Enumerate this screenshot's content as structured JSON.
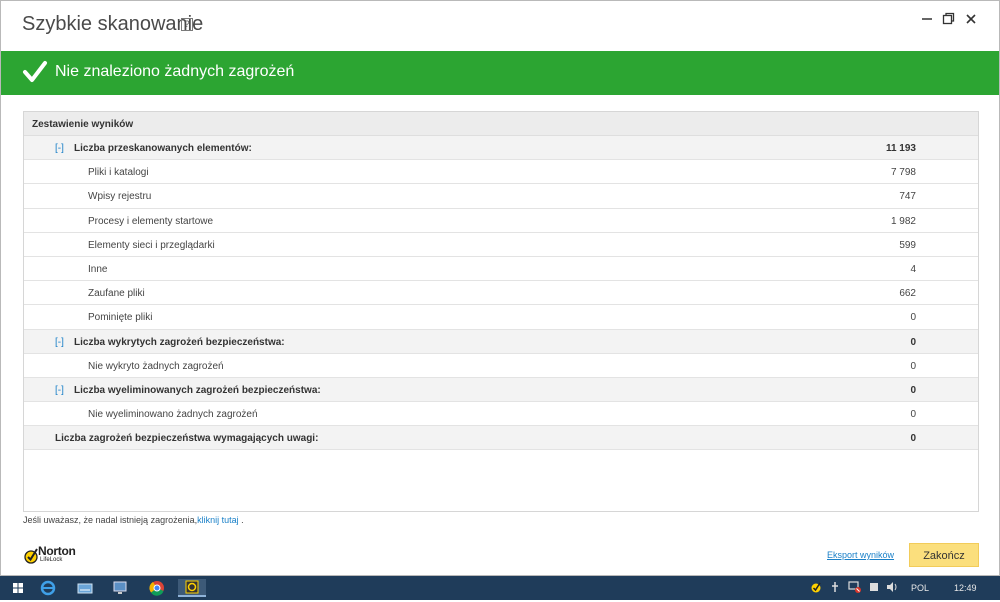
{
  "window": {
    "title": "Szybkie skanowanie",
    "help_label": "?",
    "minimize_icon": "minimize-icon",
    "restore_icon": "restore-icon",
    "close_icon": "close-icon"
  },
  "banner": {
    "text": "Nie znaleziono żadnych zagrożeń",
    "icon": "checkmark-icon",
    "color": "#2ca532"
  },
  "summary": {
    "header": "Zestawienie wyników",
    "toggle_label": "[-]",
    "rows": [
      {
        "label": "Liczba przeskanowanych elementów:",
        "value": "11 193"
      },
      {
        "label": "Pliki i katalogi",
        "value": "7 798"
      },
      {
        "label": "Wpisy rejestru",
        "value": "747"
      },
      {
        "label": "Procesy i elementy startowe",
        "value": "1 982"
      },
      {
        "label": "Elementy sieci i przeglądarki",
        "value": "599"
      },
      {
        "label": "Inne",
        "value": "4"
      },
      {
        "label": "Zaufane pliki",
        "value": "662"
      },
      {
        "label": "Pominięte pliki",
        "value": "0"
      },
      {
        "label": "Liczba wykrytych zagrożeń bezpieczeństwa:",
        "value": "0"
      },
      {
        "label": "Nie wykryto żadnych zagrożeń",
        "value": "0"
      },
      {
        "label": "Liczba wyeliminowanych zagrożeń bezpieczeństwa:",
        "value": "0"
      },
      {
        "label": "Nie wyeliminowano żadnych zagrożeń",
        "value": "0"
      },
      {
        "label": "Liczba zagrożeń bezpieczeństwa wymagających uwagi:",
        "value": "0"
      }
    ]
  },
  "footer": {
    "note": "Jeśli uważasz, że nadal istnieją zagrożenia,",
    "link": "kliknij tutaj",
    "note_end": " .",
    "brand": "Norton",
    "brand_sub": "LifeLock",
    "export_label": "Eksport wyników",
    "finish_label": "Zakończ",
    "finish_color": "#fbdf7d"
  },
  "taskbar": {
    "items": [
      "windows-start-icon",
      "edge-icon",
      "keyboard-icon",
      "network-computer-icon",
      "chrome-icon",
      "norton-app-icon"
    ],
    "language": "POL",
    "time": "12:49"
  }
}
